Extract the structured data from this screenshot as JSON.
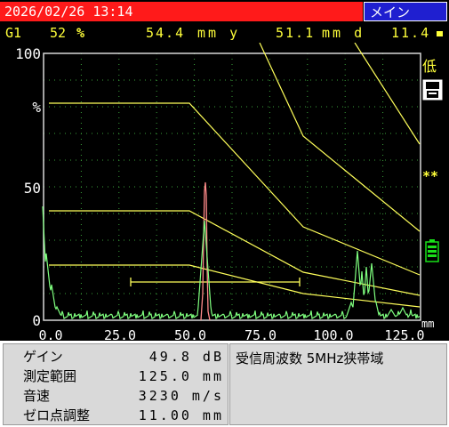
{
  "header": {
    "datetime": "2026/02/26 13:14",
    "menu_label": "メイン"
  },
  "status": {
    "gate": "G1",
    "amplitude": "52",
    "amplitude_unit": "%",
    "depth_y": "54.4",
    "depth_y_unit": "mm y",
    "depth_d": "51.1",
    "depth_d_unit": "mm d",
    "extra": "11.4"
  },
  "side": {
    "low_label": "低",
    "stars": "**"
  },
  "axes": {
    "y_top": "100",
    "y_pct": "%",
    "y_mid": "50",
    "y_zero": "0",
    "x_ticks": [
      "0.0",
      "25.0",
      "50.0",
      "75.0",
      "100.0",
      "125.0"
    ],
    "x_unit": "mm"
  },
  "colors": {
    "trace": "#7fff7f",
    "curves": "#ffff5a",
    "gate": "#ffff5a",
    "echo": "#ff8a8a",
    "grid": "#3aa03a"
  },
  "params": [
    {
      "label": "ゲイン",
      "value": "49.8 dB"
    },
    {
      "label": "測定範囲",
      "value": "125.0 mm"
    },
    {
      "label": "音速",
      "value": "3230 m/s"
    },
    {
      "label": "ゼロ点調整",
      "value": "11.00 mm"
    }
  ],
  "probe_info": "受信周波数 5MHz狭帯域"
}
